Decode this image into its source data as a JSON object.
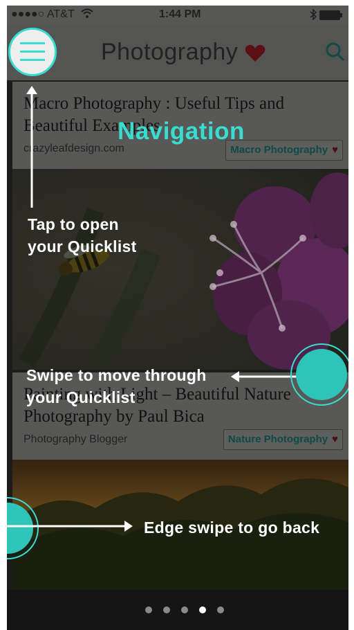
{
  "status_bar": {
    "carrier": "●●●●○ AT&T",
    "time": "1:44 PM"
  },
  "app_bar": {
    "title": "Photography"
  },
  "cards": [
    {
      "title_line1": "Macro Photography : Useful Tips and",
      "title_line2": "Beautiful Examples",
      "source": "crazyleafdesign.com",
      "tag": "Macro Photography"
    },
    {
      "title_line1": "Painting with Light – Beautiful Nature",
      "title_line2": "Photography by Paul Bica",
      "source": "Photography Blogger",
      "tag": "Nature Photography"
    }
  ],
  "tutorial": {
    "title": "Navigation",
    "tap_line1": "Tap to open",
    "tap_line2": "your Quicklist",
    "swipe_line1": "Swipe to move through",
    "swipe_line2": "your Quicklist",
    "edge": "Edge swipe to go back"
  },
  "pager": {
    "count": 5,
    "active_index": 3
  },
  "colors": {
    "accent": "#38ddd0",
    "heart": "#8b1a22"
  },
  "icons": [
    "menu-icon",
    "heart-icon",
    "search-icon",
    "wifi-icon",
    "battery-icon",
    "bluetooth-icon"
  ]
}
